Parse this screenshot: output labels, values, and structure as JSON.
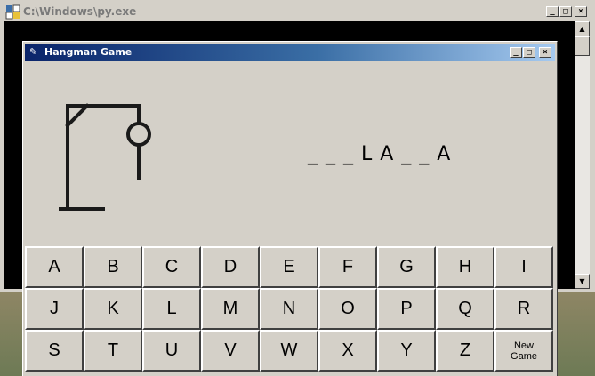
{
  "console": {
    "title": "C:\\Windows\\py.exe",
    "minimize": "_",
    "maximize": "□",
    "close": "×"
  },
  "hangman": {
    "title": "Hangman Game",
    "minimize": "_",
    "maximize": "□",
    "close": "×",
    "word_display": "_ _ _ L A _ _ A",
    "keys": [
      "A",
      "B",
      "C",
      "D",
      "E",
      "F",
      "G",
      "H",
      "I",
      "J",
      "K",
      "L",
      "M",
      "N",
      "O",
      "P",
      "Q",
      "R",
      "S",
      "T",
      "U",
      "V",
      "W",
      "X",
      "Y",
      "Z"
    ],
    "new_game_label": "New\nGame"
  }
}
